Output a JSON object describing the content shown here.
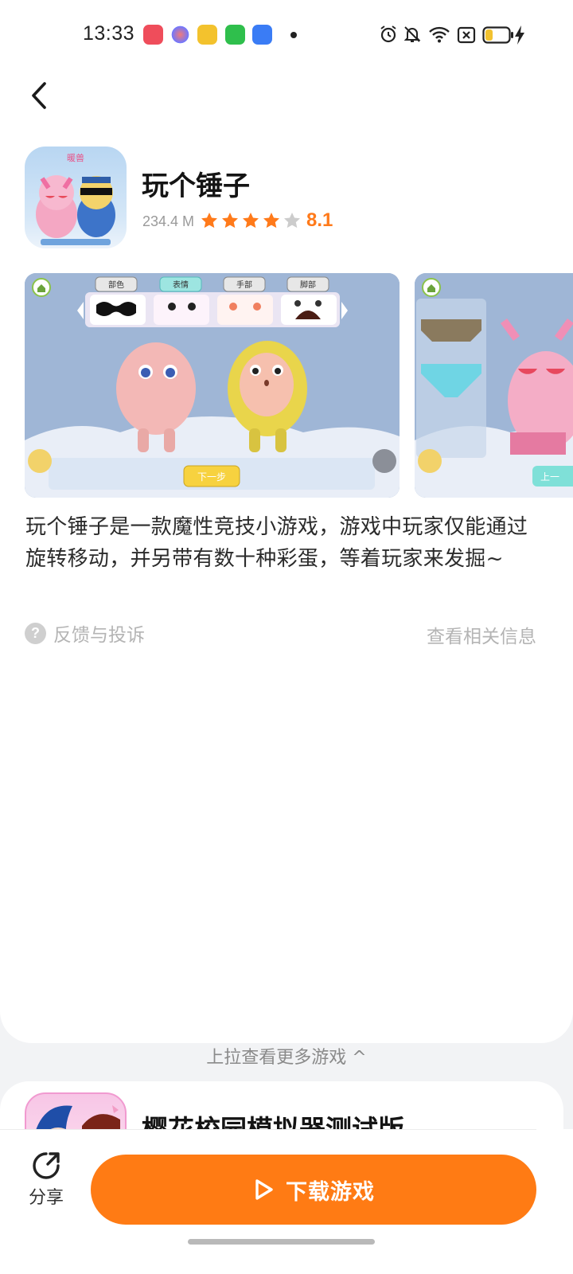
{
  "status_bar": {
    "time": "13:33",
    "icons": [
      "app-notification-icon",
      "app-notification-icon",
      "app-notification-icon",
      "app-notification-icon",
      "app-notification-icon",
      "alarm-icon",
      "mute-icon",
      "wifi-icon",
      "sim-icon",
      "battery-icon",
      "charging-icon"
    ]
  },
  "app": {
    "title": "玩个锤子",
    "size": "234.4 M",
    "rating_value": 8.1,
    "rating_text": "8.1",
    "stars_filled": 4,
    "stars_total": 5,
    "description": "玩个锤子是一款魔性竞技小游戏，游戏中玩家仅能通过旋转移动，并另带有数十种彩蛋，等着玩家来发掘~",
    "icon_badge": "暖兽"
  },
  "screenshots": {
    "shot1_tabs": [
      "部色",
      "表情",
      "手部",
      "脚部"
    ],
    "shot1_button": "下一步",
    "shot2_button": "上一"
  },
  "links": {
    "feedback": "反馈与投诉",
    "related_info": "查看相关信息"
  },
  "pull_hint": "上拉查看更多游戏 ^",
  "next_game": {
    "title": "樱花校园模拟器测试版"
  },
  "bottom_bar": {
    "share_label": "分享",
    "download_label": "下载游戏"
  },
  "colors": {
    "accent": "#ff7b14",
    "star_on": "#ff7a1a",
    "star_off": "#cccccc"
  }
}
